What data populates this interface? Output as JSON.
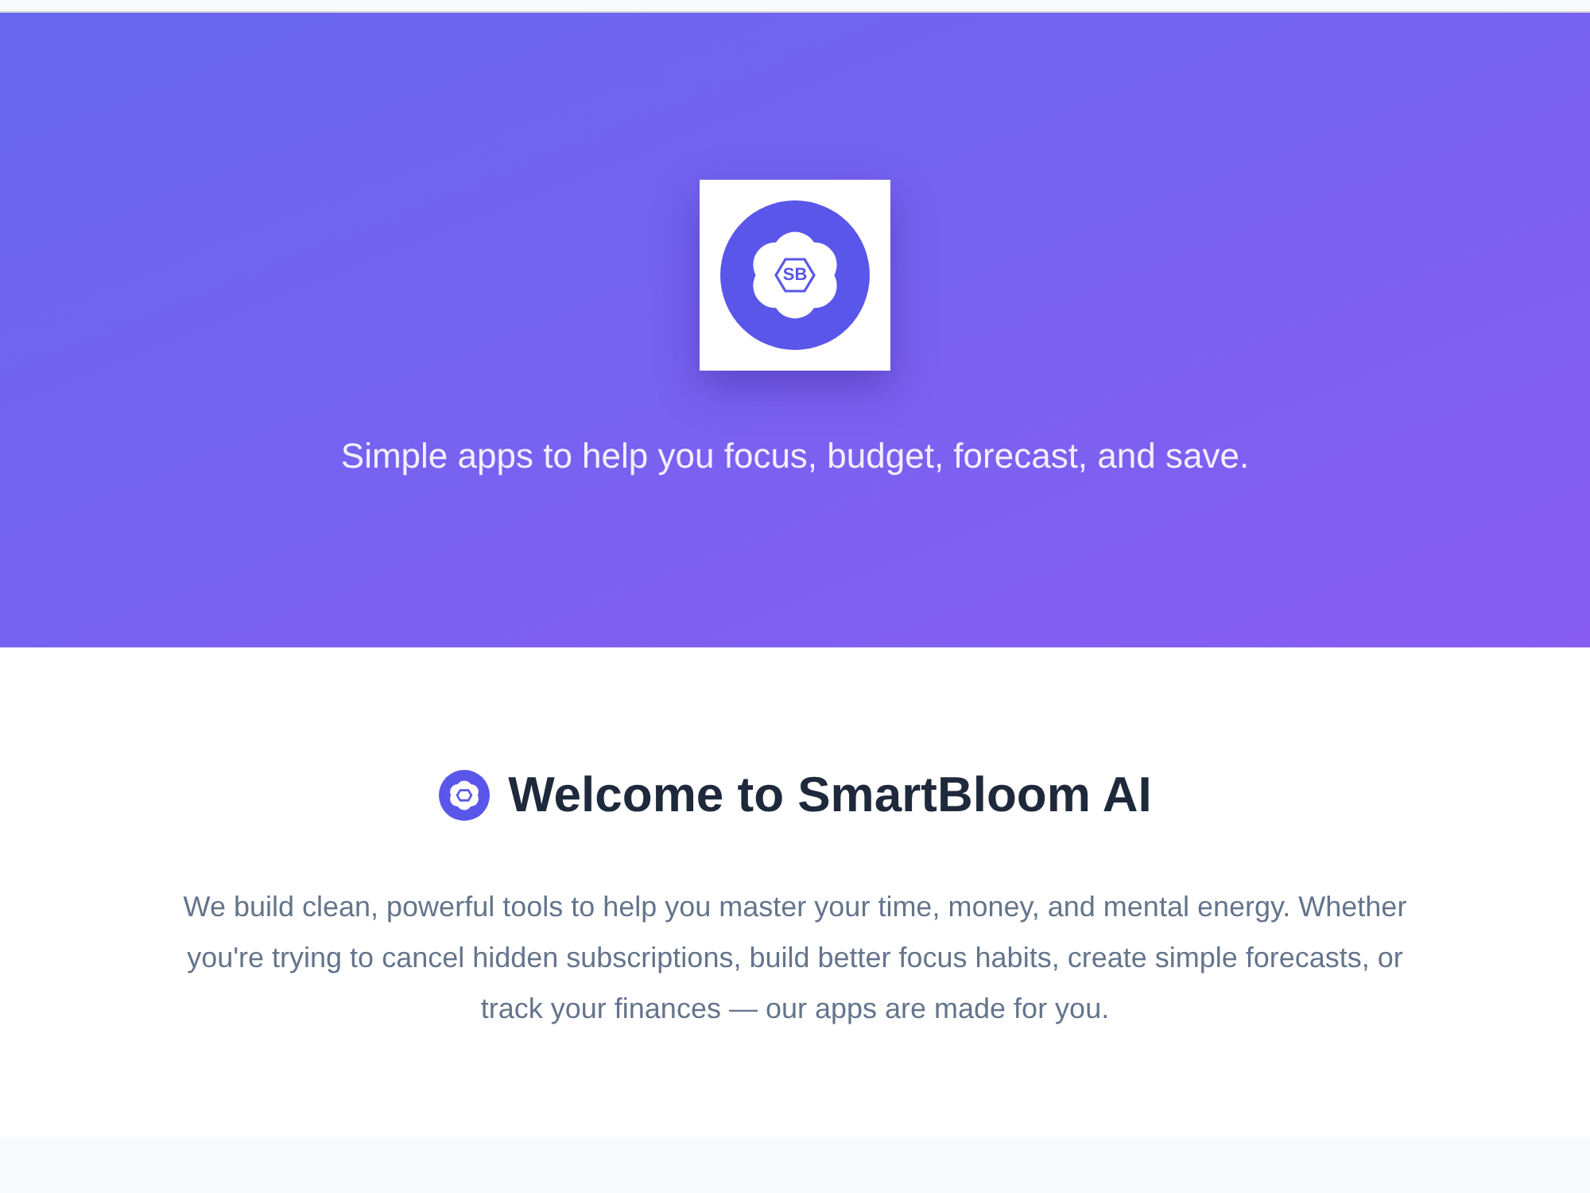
{
  "hero": {
    "logo_text": "SB",
    "tagline": "Simple apps to help you focus, budget, forecast, and save."
  },
  "welcome": {
    "heading": "Welcome to SmartBloom AI",
    "body": "We build clean, powerful tools to help you master your time, money, and mental energy. Whether you're trying to cancel hidden subscriptions, build better focus habits, create simple forecasts, or track your finances — our apps are made for you."
  }
}
